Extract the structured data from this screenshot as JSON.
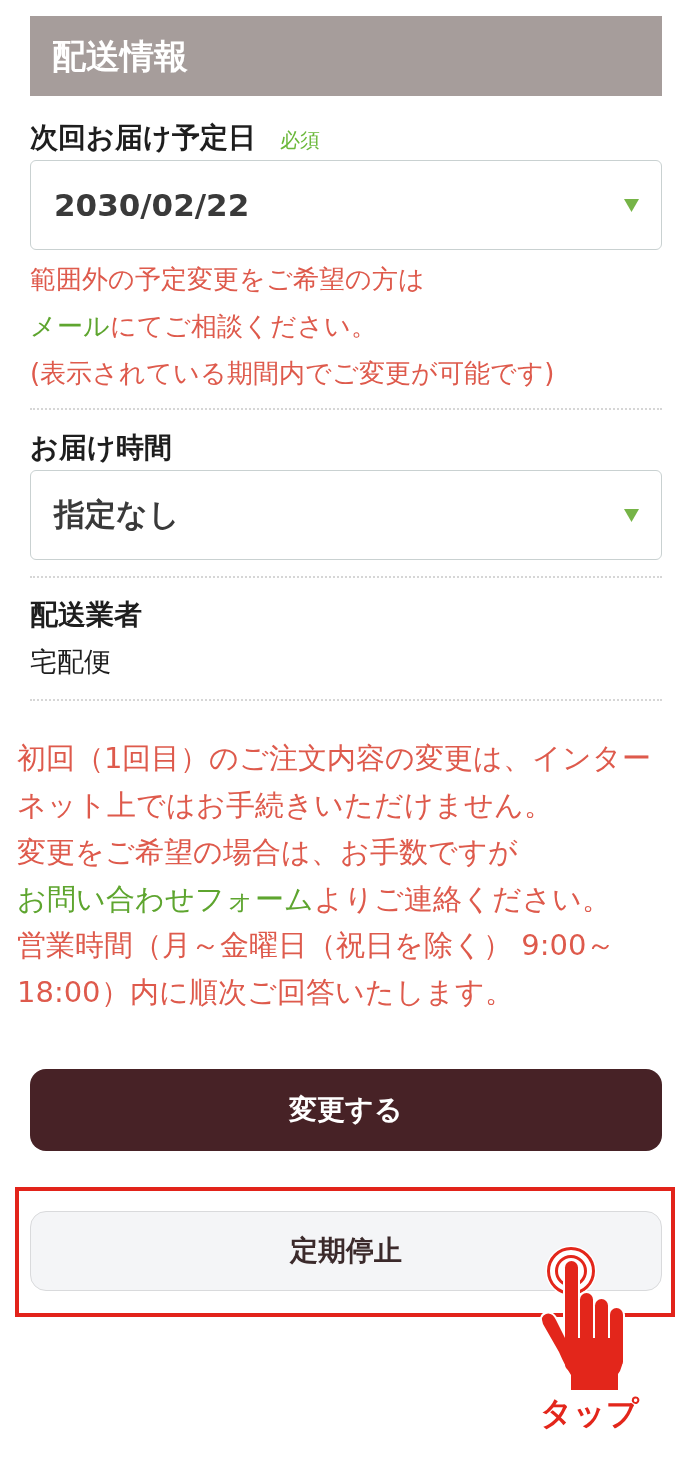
{
  "section": {
    "title": "配送情報"
  },
  "fields": [
    {
      "kind": "select",
      "label": "次回お届け予定日",
      "required_badge": "必須",
      "value": "2030/02/22",
      "notes": [
        {
          "parts": [
            {
              "kind": "text",
              "text": "範囲外の予定変更をご希望の方は"
            }
          ]
        },
        {
          "parts": [
            {
              "kind": "link",
              "text": "メール"
            },
            {
              "kind": "text",
              "text": "にてご相談ください。"
            }
          ]
        },
        {
          "parts": [
            {
              "kind": "text",
              "text": "(表示されている期間内でご変更が可能です)"
            }
          ]
        }
      ]
    },
    {
      "kind": "select",
      "label": "お届け時間",
      "value": "指定なし"
    },
    {
      "kind": "static",
      "label": "配送業者",
      "value": "宅配便"
    }
  ],
  "notice": {
    "paragraphs": [
      {
        "parts": [
          {
            "kind": "text",
            "text": "初回（1回目）のご注文内容の変更は、インターネット上ではお手続きいただけません。"
          }
        ]
      },
      {
        "parts": [
          {
            "kind": "text",
            "text": "変更をご希望の場合は、お手数ですが"
          },
          {
            "kind": "link",
            "text": "お問い合わせフォーム"
          },
          {
            "kind": "text",
            "text": "よりご連絡ください。"
          }
        ]
      },
      {
        "parts": [
          {
            "kind": "text",
            "text": "営業時間（月～金曜日（祝日を除く） 9:00～18:00）内に順次ご回答いたします。"
          }
        ]
      }
    ]
  },
  "buttons": [
    {
      "kind": "primary",
      "label": "変更する",
      "highlighted": false
    },
    {
      "kind": "secondary",
      "label": "定期停止",
      "highlighted": true
    }
  ],
  "tap_hint": {
    "label": "タップ"
  }
}
